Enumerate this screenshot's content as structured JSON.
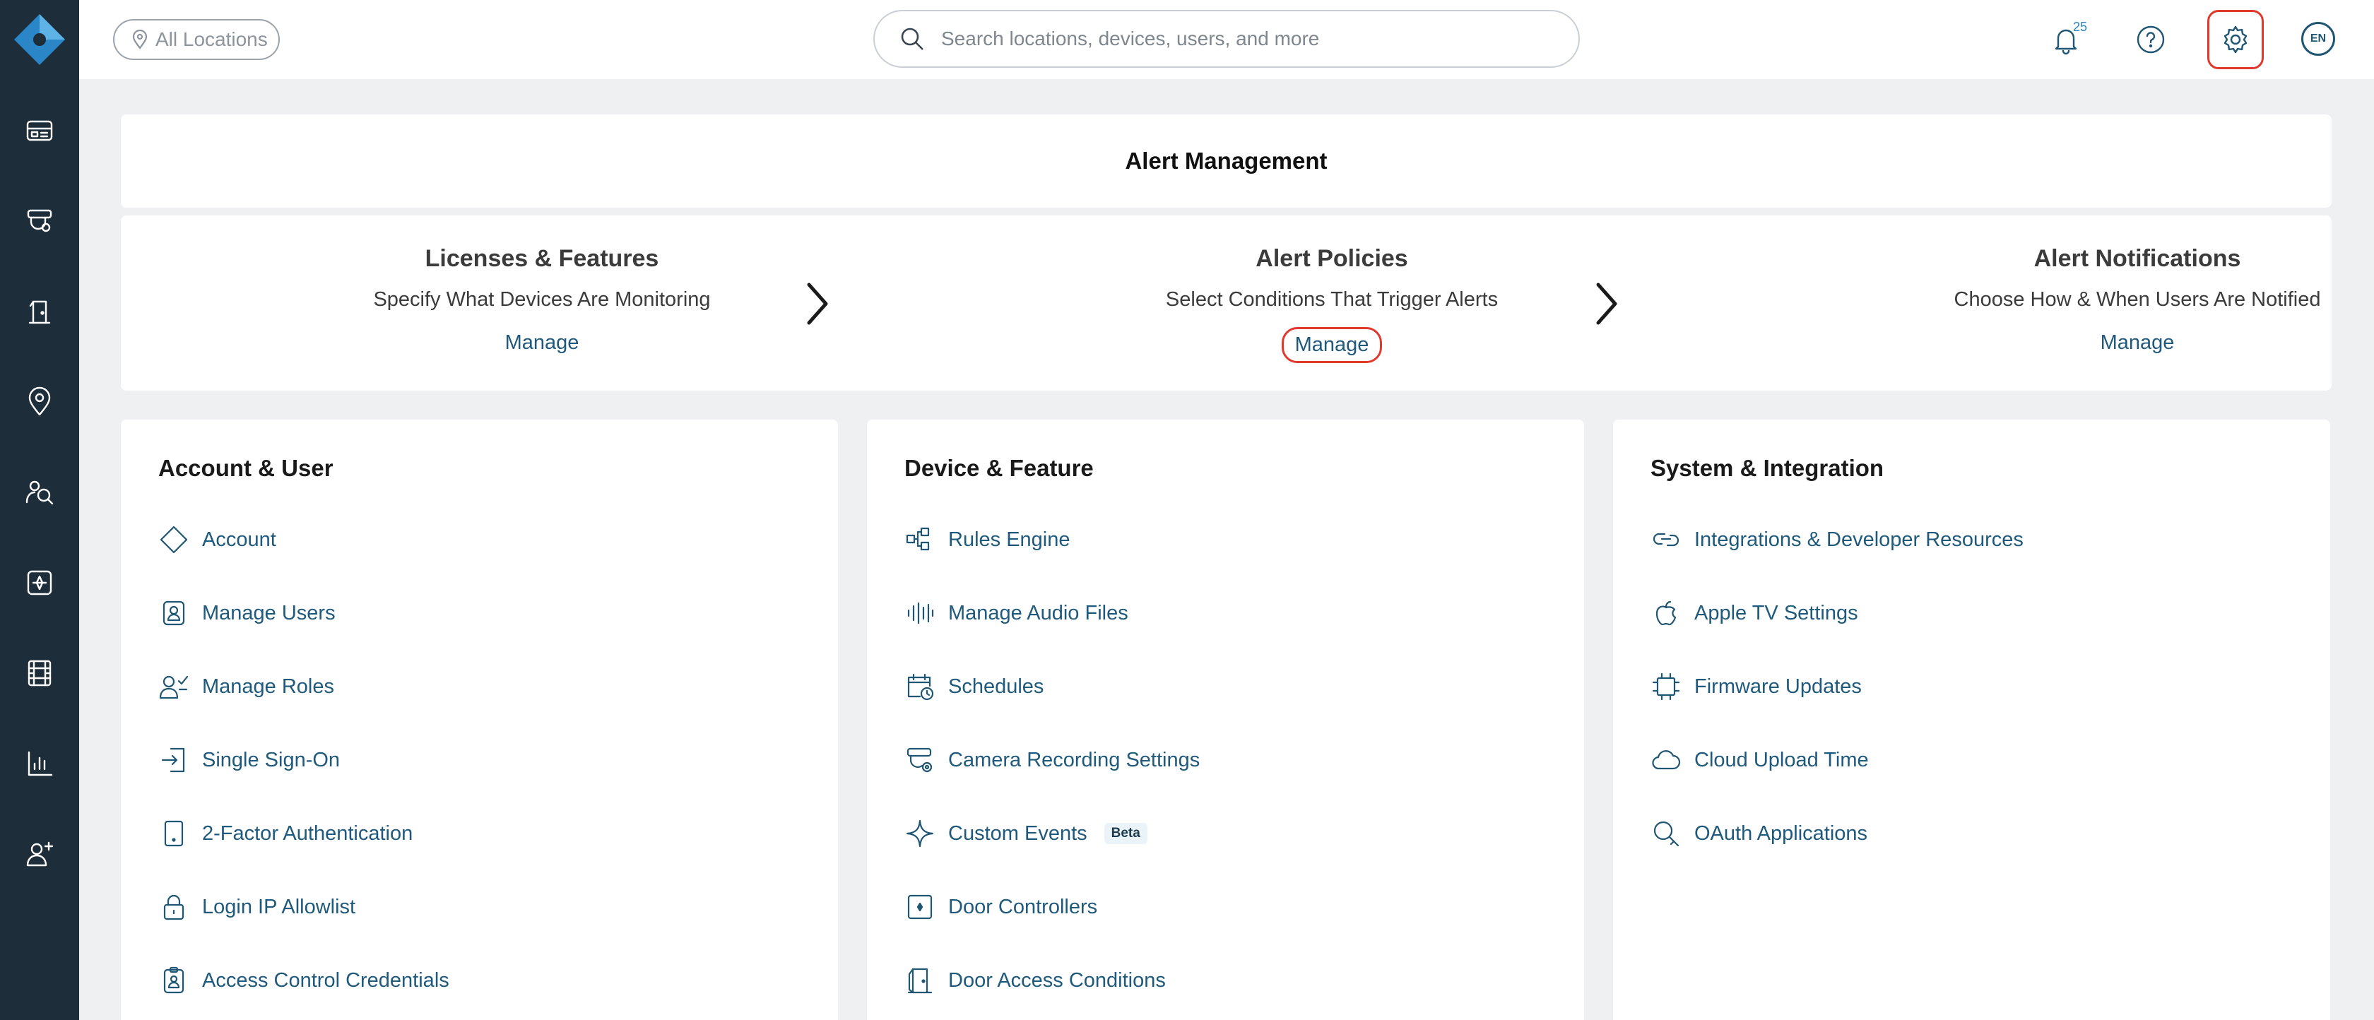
{
  "topbar": {
    "location_label": "All Locations",
    "search_placeholder": "Search locations, devices, users, and more",
    "notification_count": "25",
    "language": "EN"
  },
  "sidebar": {
    "icons": [
      "dashboard-icon",
      "camera-icon",
      "door-icon",
      "location-pin-icon",
      "people-search-icon",
      "access-control-icon",
      "video-archive-icon",
      "analytics-chart-icon",
      "add-user-icon"
    ]
  },
  "alert_management": {
    "title": "Alert Management",
    "steps": [
      {
        "title": "Licenses & Features",
        "desc": "Specify What Devices Are Monitoring",
        "link": "Manage"
      },
      {
        "title": "Alert Policies",
        "desc": "Select Conditions That Trigger Alerts",
        "link": "Manage"
      },
      {
        "title": "Alert Notifications",
        "desc": "Choose How & When Users Are Notified",
        "link": "Manage"
      }
    ]
  },
  "sections": {
    "account": {
      "title": "Account & User",
      "items": [
        "Account",
        "Manage Users",
        "Manage Roles",
        "Single Sign-On",
        "2-Factor Authentication",
        "Login IP Allowlist",
        "Access Control Credentials"
      ]
    },
    "device": {
      "title": "Device & Feature",
      "items": [
        "Rules Engine",
        "Manage Audio Files",
        "Schedules",
        "Camera Recording Settings",
        "Custom Events",
        "Door Controllers",
        "Door Access Conditions"
      ],
      "beta_label": "Beta"
    },
    "system": {
      "title": "System & Integration",
      "items": [
        "Integrations & Developer Resources",
        "Apple TV Settings",
        "Firmware Updates",
        "Cloud Upload Time",
        "OAuth Applications"
      ]
    }
  },
  "colors": {
    "sidebar_bg": "#1d2d3a",
    "link": "#1f5a7d",
    "highlight": "#e03a2f",
    "logo": "#2a86c7"
  }
}
